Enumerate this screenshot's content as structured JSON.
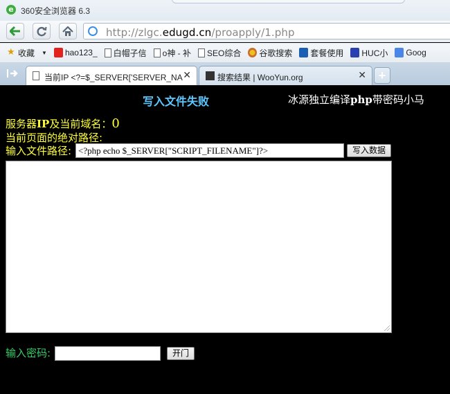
{
  "window": {
    "title": "360安全浏览器 6.3",
    "logo": "e"
  },
  "nav": {
    "back_icon": "arrow-left-icon",
    "refresh_icon": "refresh-icon",
    "home_icon": "home-icon",
    "url_prefix": "http://zlgc.",
    "url_domain": "edugd.cn",
    "url_path": "/proapply/1.php"
  },
  "bookmarks": [
    {
      "label": "收藏",
      "icon": "star-icon"
    },
    {
      "label": "hao123_",
      "icon": "hao123-icon"
    },
    {
      "label": "白帽子信",
      "icon": "page-icon"
    },
    {
      "label": "o神 - 补",
      "icon": "page-icon"
    },
    {
      "label": "SEO综合",
      "icon": "page-icon"
    },
    {
      "label": "谷歌搜索",
      "icon": "google-icon"
    },
    {
      "label": "套餐使用",
      "icon": "telecom-icon"
    },
    {
      "label": "HUC小",
      "icon": "paw-icon"
    },
    {
      "label": "Goog",
      "icon": "google-g-icon"
    }
  ],
  "tabs": [
    {
      "label": "当前IP <?=$_SERVER['SERVER_NA",
      "active": true
    },
    {
      "label": "搜索结果 | WooYun.org",
      "active": false
    }
  ],
  "content": {
    "title": "写入文件失败",
    "right_prefix": "冰源独立编译",
    "right_php": "php",
    "right_suffix": "带密码小马",
    "ip_label_a": "服务器",
    "ip_label_ip": "IP",
    "ip_label_b": "及当前域名：",
    "ip_value": "0",
    "abs_path_label": "当前页面的绝对路径:",
    "file_path_label": "输入文件路径:",
    "file_path_value": "<?php echo $_SERVER[\"SCRIPT_FILENAME\"]?>",
    "write_button": "写入数据",
    "password_label": "输入密码:",
    "password_value": "",
    "open_button": "开门"
  },
  "colors": {
    "title": "#5cc8ff",
    "yellow_text": "#ffff33",
    "green_text": "#33cc66",
    "background": "#000000"
  }
}
